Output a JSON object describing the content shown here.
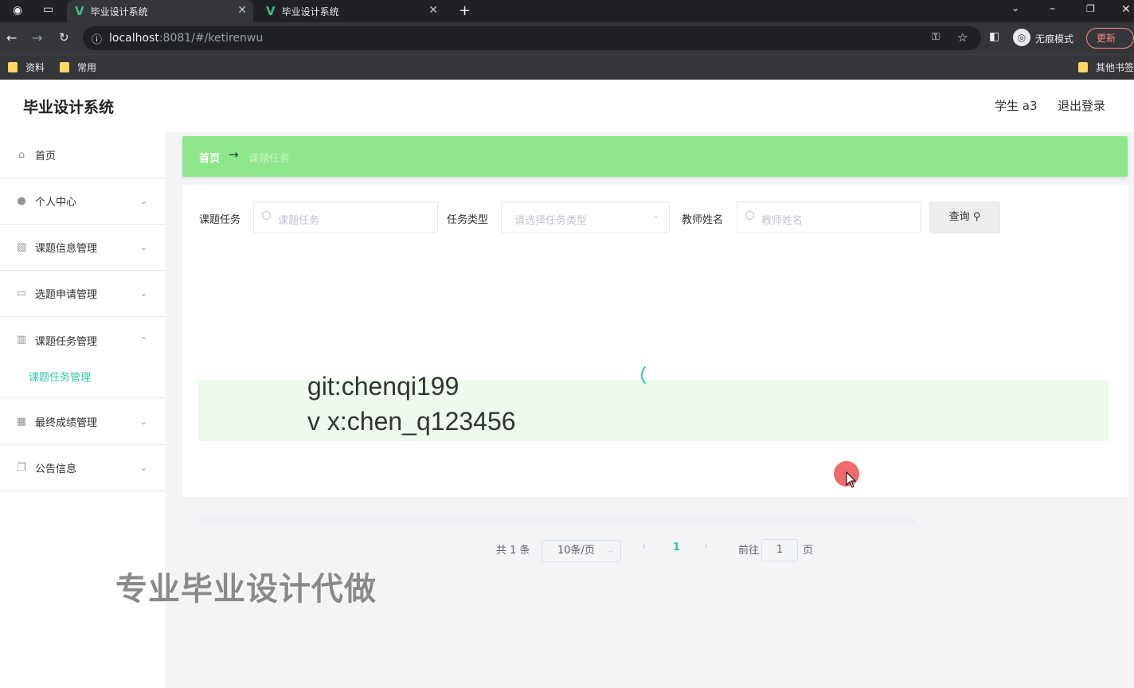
{
  "browser": {
    "tabs": [
      {
        "title": "毕业设计系统",
        "active": true
      },
      {
        "title": "毕业设计系统",
        "active": false
      }
    ],
    "url_host": "localhost",
    "url_rest": ":8081/#/ketirenwu",
    "incognito_label": "无痕模式",
    "update_label": "更新",
    "bookmarks": [
      "资料",
      "常用"
    ],
    "other_bookmarks": "其他书签"
  },
  "header": {
    "title": "毕业设计系统",
    "user": "学生 a3",
    "logout": "退出登录"
  },
  "sidebar": {
    "items": [
      {
        "label": "首页",
        "icon": "home-icon",
        "glyph": "⌂"
      },
      {
        "label": "个人中心",
        "icon": "user-icon",
        "glyph": "👤"
      },
      {
        "label": "课题信息管理",
        "icon": "chart-icon",
        "glyph": "▨"
      },
      {
        "label": "选题申请管理",
        "icon": "message-icon",
        "glyph": "▭"
      },
      {
        "label": "课题任务管理",
        "icon": "books-icon",
        "glyph": "▥"
      },
      {
        "label": "最终成绩管理",
        "icon": "grid-icon",
        "glyph": "▦"
      },
      {
        "label": "公告信息",
        "icon": "copy-icon",
        "glyph": "❐"
      }
    ],
    "subitem": "课题任务管理",
    "accent": "#2ec8a6"
  },
  "breadcrumb": {
    "home": "首页",
    "arrow": "→",
    "current": "课题任务",
    "bg": "#8ee68a"
  },
  "search": {
    "task_label": "课题任务",
    "task_placeholder": "课题任务",
    "type_label": "任务类型",
    "type_placeholder": "请选择任务类型",
    "teacher_label": "教师姓名",
    "teacher_placeholder": "教师姓名",
    "query_button": "查询"
  },
  "pagination": {
    "total": "共 1 条",
    "page_size": "10条/页",
    "current_page": "1",
    "goto_label": "前往",
    "goto_value": "1",
    "page_suffix": "页"
  },
  "overlay": {
    "git": "git:chenqi199",
    "vx": "v x:chen_q123456",
    "ad": "专业毕业设计代做"
  }
}
